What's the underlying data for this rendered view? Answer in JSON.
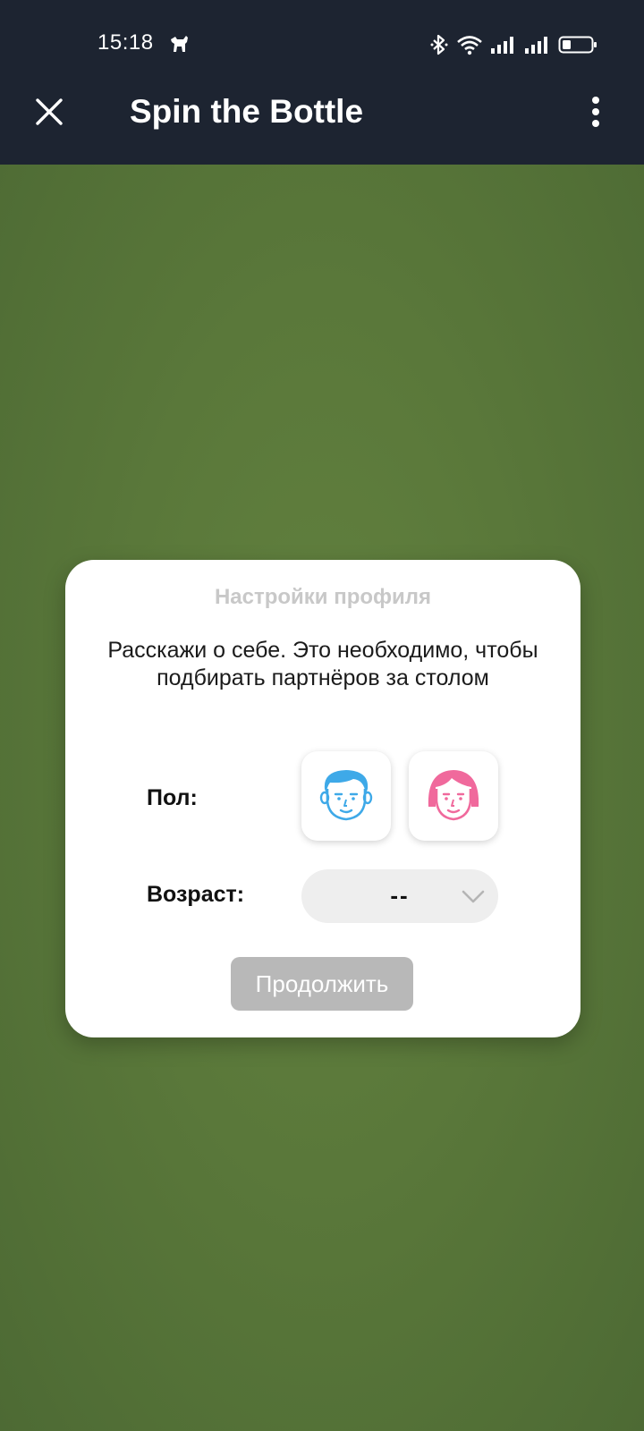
{
  "status_bar": {
    "time": "15:18",
    "icons": [
      "dog-notification-icon",
      "bluetooth-icon",
      "wifi-icon",
      "signal-icon",
      "signal-icon",
      "battery-icon"
    ]
  },
  "header": {
    "title": "Spin the Bottle",
    "close_icon": "close-icon",
    "menu_icon": "more-vertical-icon"
  },
  "dialog": {
    "title": "Настройки профиля",
    "description": "Расскажи о себе. Это необходимо, чтобы подбирать партнёров за столом",
    "gender_label": "Пол:",
    "gender_options": [
      "male-avatar-icon",
      "female-avatar-icon"
    ],
    "age_label": "Возраст:",
    "age_value": "--",
    "continue_label": "Продолжить"
  },
  "colors": {
    "header_bg": "#1d2431",
    "table_green": "#55713a",
    "male_blue": "#3ea9e8",
    "female_pink": "#f0699c",
    "disabled_button": "#b8b8b8"
  }
}
